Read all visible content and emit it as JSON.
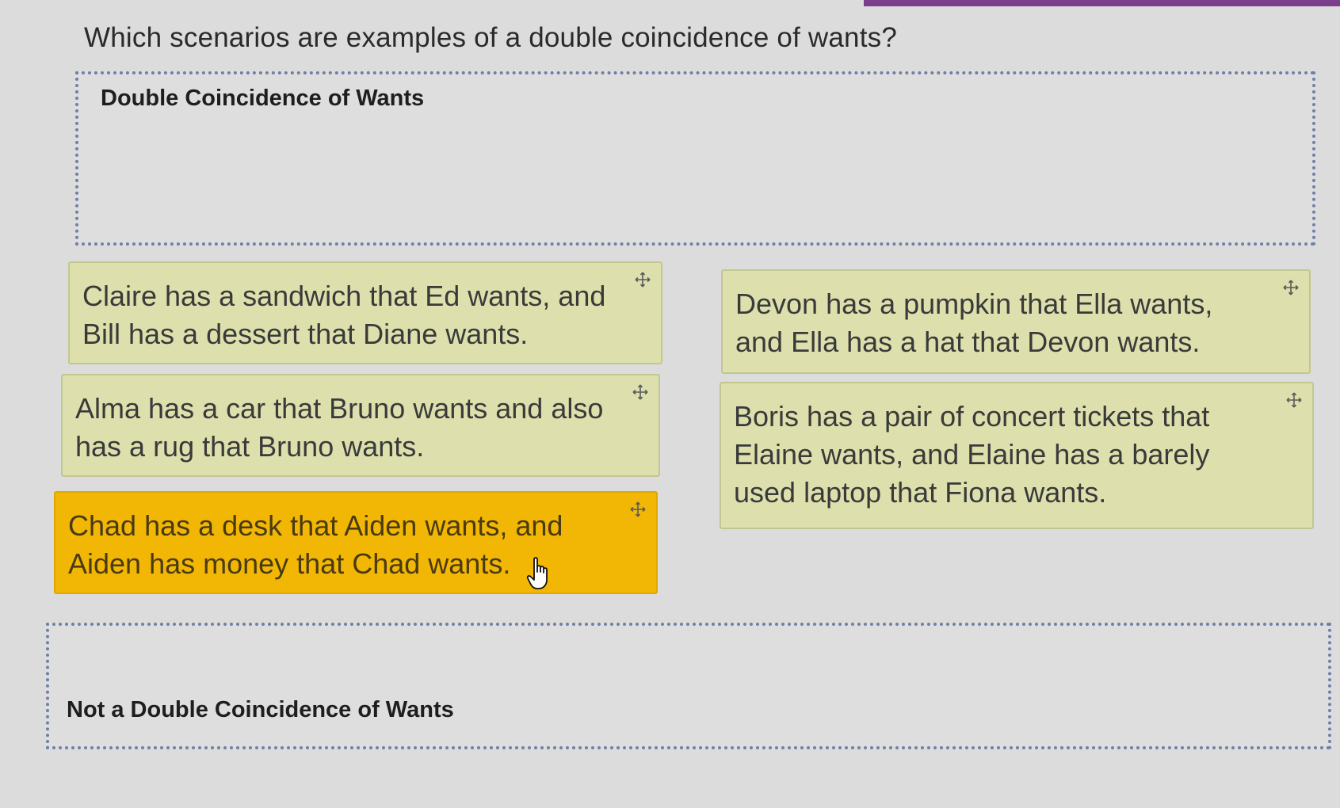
{
  "question": "Which scenarios are examples of a double coincidence of wants?",
  "zones": {
    "top_label": "Double Coincidence of Wants",
    "bottom_label": "Not a Double Coincidence of Wants"
  },
  "cards": [
    {
      "text": "Claire has a sandwich that Ed wants, and Bill has a dessert that Diane wants.",
      "state": "idle"
    },
    {
      "text": "Devon has a pumpkin that Ella wants, and Ella has a hat that Devon wants.",
      "state": "idle"
    },
    {
      "text": "Alma has a car that Bruno wants and also has a rug that Bruno wants.",
      "state": "idle"
    },
    {
      "text": "Boris has a pair of concert tickets that Elaine wants, and Elaine has a barely used laptop that Fiona wants.",
      "state": "idle"
    },
    {
      "text": "Chad has a desk that Aiden wants, and Aiden has money that Chad wants.",
      "state": "grabbed"
    }
  ],
  "icons": {
    "card_handle": "move-icon",
    "pointer": "hand-pointer-icon"
  },
  "colors": {
    "top_accent": "#7a3e8c",
    "card_background": "#dde0ac",
    "active_card_background": "#f2b705",
    "dropzone_border": "#6f7fa8"
  }
}
